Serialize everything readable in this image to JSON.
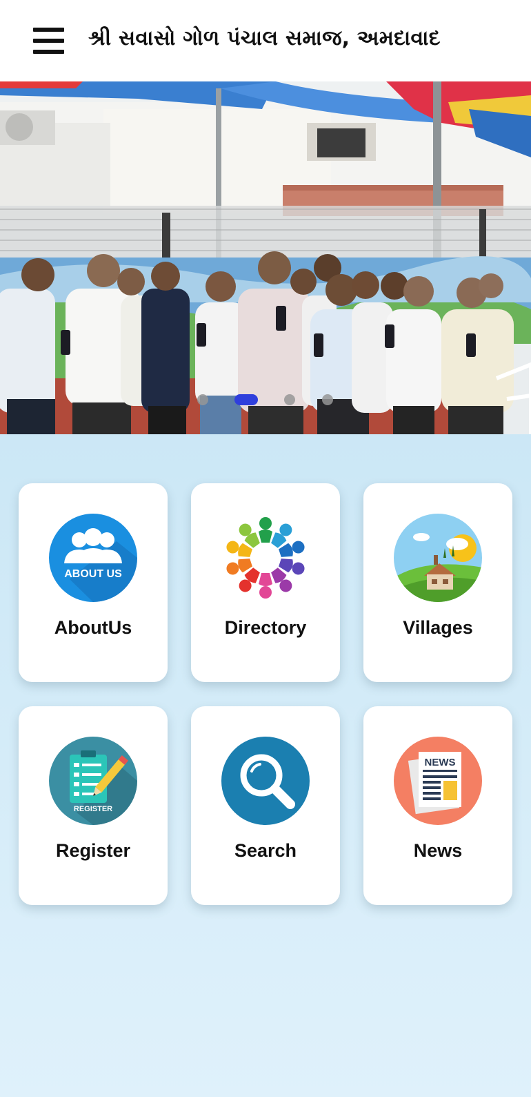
{
  "header": {
    "title": "શ્રી સવાસો ગોળ પંચાલ સમાજ, અમદાવાદ",
    "menu_icon": "hamburger-menu-icon"
  },
  "banner": {
    "slide_count": 4,
    "active_slide": 2,
    "colors": {
      "active_dot": "#2f3fdc",
      "inactive_dot": "#9a9a9a"
    }
  },
  "tiles": [
    {
      "label": "AboutUs",
      "icon": "about-us-icon",
      "icon_text": "ABOUT US",
      "color": "#1a8fe0"
    },
    {
      "label": "Directory",
      "icon": "directory-people-circle-icon",
      "color": "#ffffff"
    },
    {
      "label": "Villages",
      "icon": "village-landscape-icon",
      "color": "#8ed0f2"
    },
    {
      "label": "Register",
      "icon": "register-clipboard-icon",
      "icon_text": "REGISTER",
      "color": "#3b8fa3"
    },
    {
      "label": "Search",
      "icon": "search-magnifier-icon",
      "color": "#1b7fb0"
    },
    {
      "label": "News",
      "icon": "newspaper-icon",
      "icon_text": "NEWS",
      "color": "#f47f63"
    }
  ],
  "colors": {
    "background_top": "#bfe0f2",
    "background_bottom": "#dff1fb",
    "tile": "#ffffff",
    "text": "#111111"
  }
}
